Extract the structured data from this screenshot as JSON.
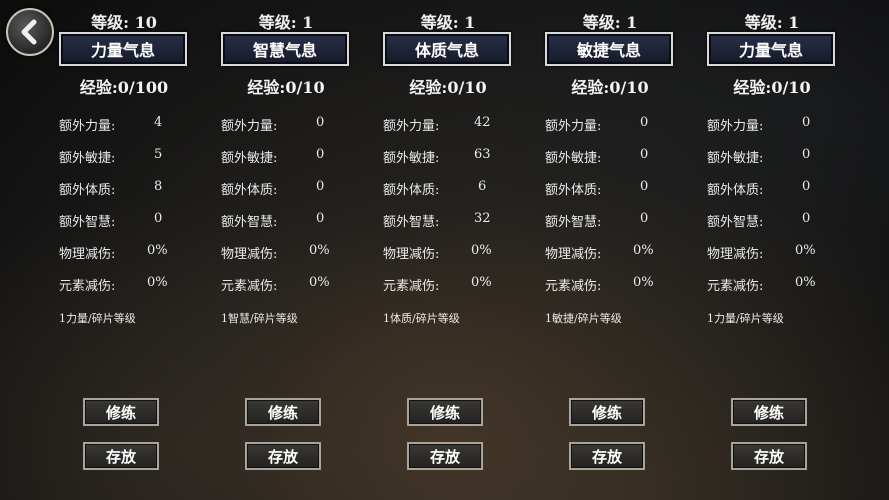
{
  "back_button": {
    "icon": "back-arrow-icon"
  },
  "columns": [
    {
      "level": "等级: 10",
      "title": "力量气息",
      "exp": "经验:0/100",
      "stats": [
        {
          "label": "额外力量:",
          "value": "4"
        },
        {
          "label": "额外敏捷:",
          "value": "5"
        },
        {
          "label": "额外体质:",
          "value": "8"
        },
        {
          "label": "额外智慧:",
          "value": "0"
        },
        {
          "label": "物理减伤:",
          "value": "0%"
        },
        {
          "label": "元素减伤:",
          "value": "0%"
        }
      ],
      "note": "1力量/碎片等级",
      "train": "修练",
      "store": "存放"
    },
    {
      "level": "等级: 1",
      "title": "智慧气息",
      "exp": "经验:0/10",
      "stats": [
        {
          "label": "额外力量:",
          "value": "0"
        },
        {
          "label": "额外敏捷:",
          "value": "0"
        },
        {
          "label": "额外体质:",
          "value": "0"
        },
        {
          "label": "额外智慧:",
          "value": "0"
        },
        {
          "label": "物理减伤:",
          "value": "0%"
        },
        {
          "label": "元素减伤:",
          "value": "0%"
        }
      ],
      "note": "1智慧/碎片等级",
      "train": "修练",
      "store": "存放"
    },
    {
      "level": "等级: 1",
      "title": "体质气息",
      "exp": "经验:0/10",
      "stats": [
        {
          "label": "额外力量:",
          "value": "42"
        },
        {
          "label": "额外敏捷:",
          "value": "63"
        },
        {
          "label": "额外体质:",
          "value": "6"
        },
        {
          "label": "额外智慧:",
          "value": "32"
        },
        {
          "label": "物理减伤:",
          "value": "0%"
        },
        {
          "label": "元素减伤:",
          "value": "0%"
        }
      ],
      "note": "1体质/碎片等级",
      "train": "修练",
      "store": "存放"
    },
    {
      "level": "等级: 1",
      "title": "敏捷气息",
      "exp": "经验:0/10",
      "stats": [
        {
          "label": "额外力量:",
          "value": "0"
        },
        {
          "label": "额外敏捷:",
          "value": "0"
        },
        {
          "label": "额外体质:",
          "value": "0"
        },
        {
          "label": "额外智慧:",
          "value": "0"
        },
        {
          "label": "物理减伤:",
          "value": "0%"
        },
        {
          "label": "元素减伤:",
          "value": "0%"
        }
      ],
      "note": "1敏捷/碎片等级",
      "train": "修练",
      "store": "存放"
    },
    {
      "level": "等级: 1",
      "title": "力量气息",
      "exp": "经验:0/10",
      "stats": [
        {
          "label": "额外力量:",
          "value": "0"
        },
        {
          "label": "额外敏捷:",
          "value": "0"
        },
        {
          "label": "额外体质:",
          "value": "0"
        },
        {
          "label": "额外智慧:",
          "value": "0"
        },
        {
          "label": "物理减伤:",
          "value": "0%"
        },
        {
          "label": "元素减伤:",
          "value": "0%"
        }
      ],
      "note": "1力量/碎片等级",
      "train": "修练",
      "store": "存放"
    }
  ],
  "colors": {
    "title_bg": "#1c2133",
    "title_border": "#d8d8d8",
    "button_border": "#a9a49a"
  }
}
